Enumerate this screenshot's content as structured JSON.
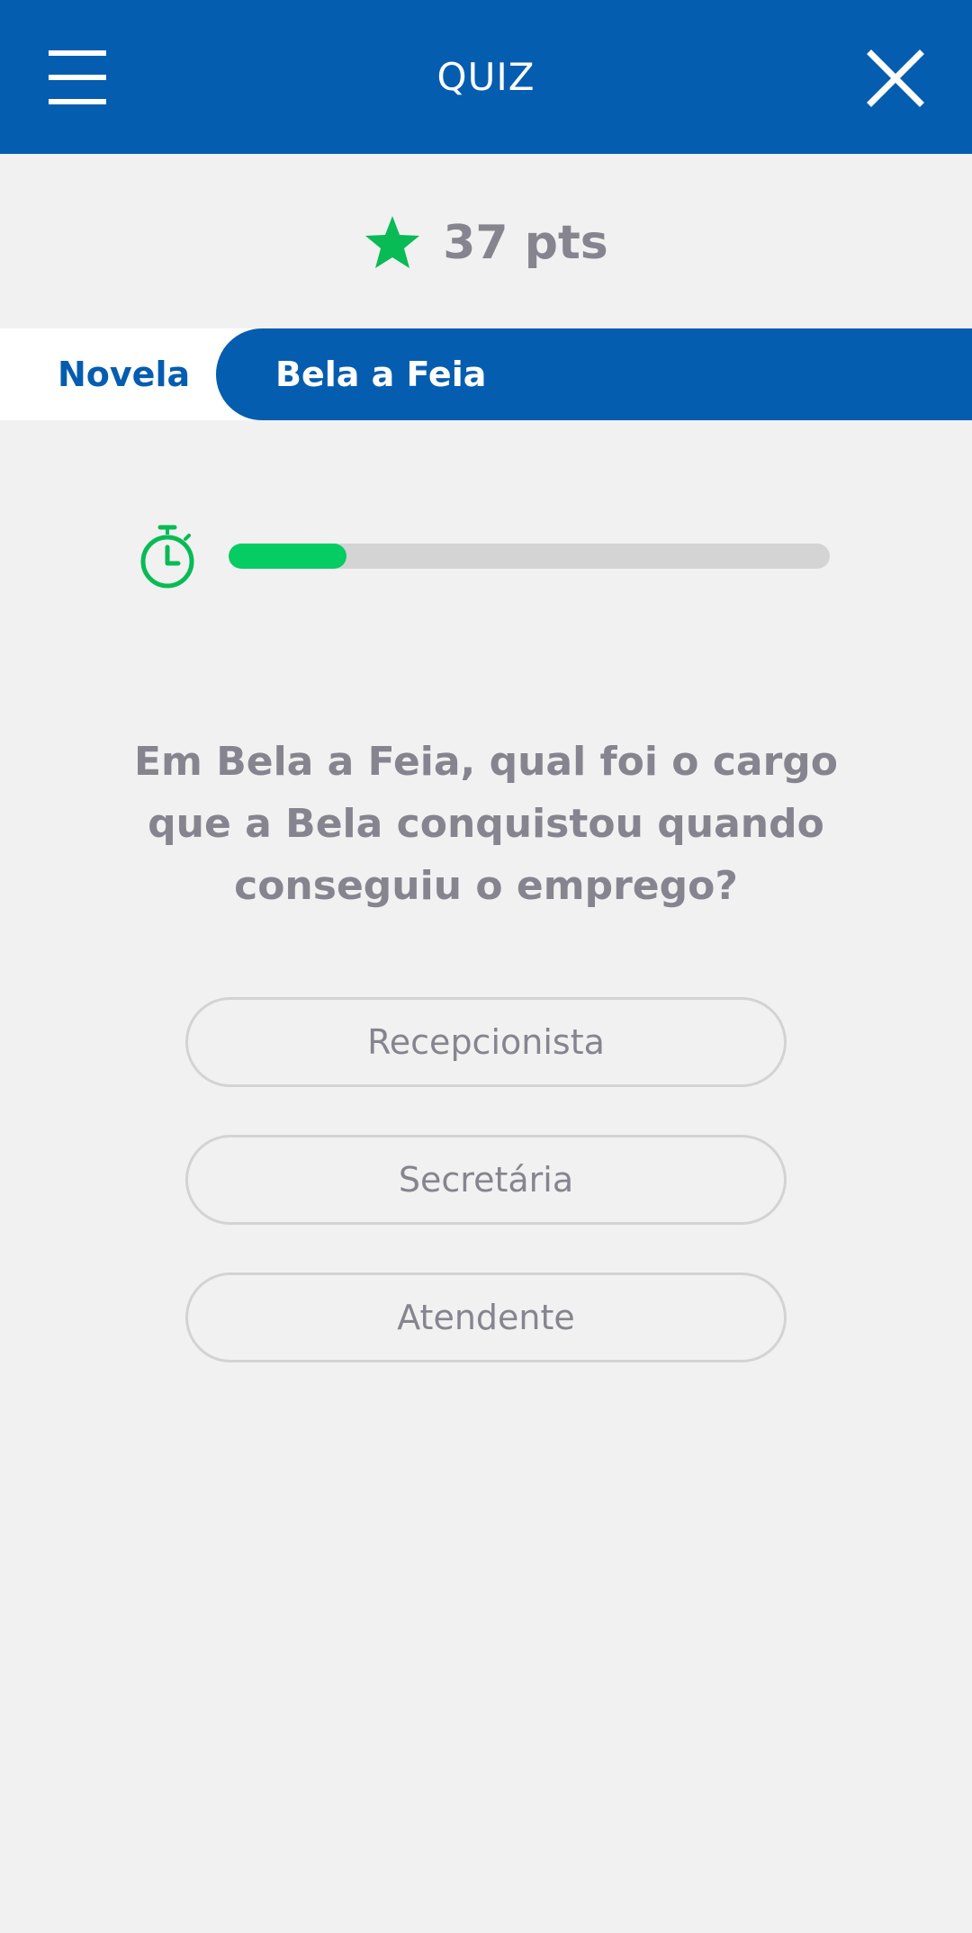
{
  "header": {
    "title": "QUIZ",
    "menu_icon": "hamburger-menu-icon",
    "close_icon": "close-icon",
    "background_color": "#055db0"
  },
  "score": {
    "icon": "star-icon",
    "icon_color": "#08bb55",
    "text": "37 pts"
  },
  "category": {
    "label": "Novela",
    "title": "Bela a Feia"
  },
  "timer": {
    "icon": "stopwatch-icon",
    "progress": 0.196,
    "fill_color": "#05cc63",
    "track_color": "#d4d4d4"
  },
  "question": {
    "text": "Em Bela a Feia, qual foi o cargo que a Bela conquistou quando conseguiu o emprego?"
  },
  "answers": [
    {
      "label": "Recepcionista"
    },
    {
      "label": "Secretária"
    },
    {
      "label": "Atendente"
    }
  ]
}
